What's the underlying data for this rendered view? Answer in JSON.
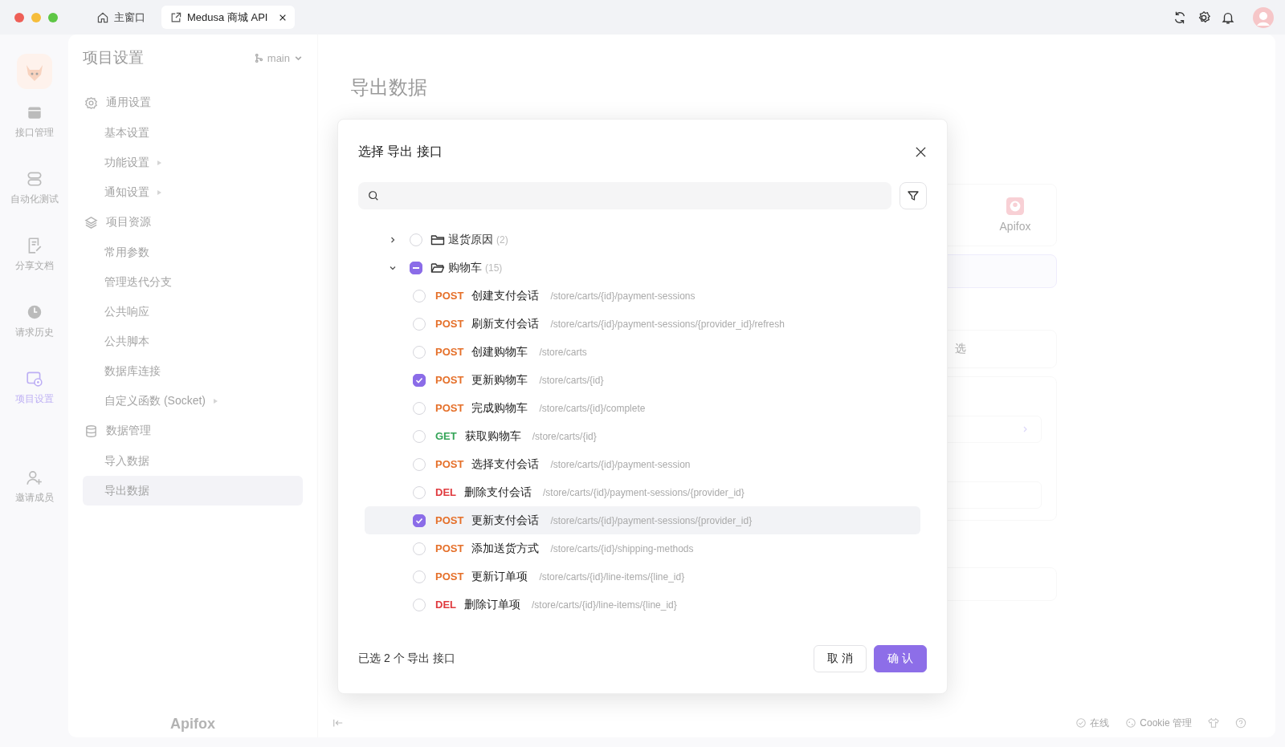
{
  "tabs": [
    {
      "kind": "home",
      "label": "主窗口",
      "selected": false
    },
    {
      "kind": "project",
      "label": "Medusa 商城 API",
      "selected": true
    }
  ],
  "rail": [
    {
      "kind": "api",
      "label": "接口管理",
      "selected": false
    },
    {
      "kind": "automation",
      "label": "自动化测试",
      "selected": false
    },
    {
      "kind": "docs",
      "label": "分享文档",
      "selected": false
    },
    {
      "kind": "history",
      "label": "请求历史",
      "selected": false
    },
    {
      "kind": "settings",
      "label": "项目设置",
      "selected": true
    },
    {
      "kind": "invite",
      "label": "邀请成员",
      "selected": false
    }
  ],
  "sidebar": {
    "title": "项目设置",
    "branch": "main",
    "brand": "Apifox",
    "groups": [
      {
        "kind": "settings",
        "label": "通用设置",
        "items": [
          {
            "label": "基本设置",
            "submenu": false,
            "selected": false
          },
          {
            "label": "功能设置",
            "submenu": true,
            "selected": false
          },
          {
            "label": "通知设置",
            "submenu": true,
            "selected": false
          }
        ]
      },
      {
        "kind": "resources",
        "label": "项目资源",
        "items": [
          {
            "label": "常用参数",
            "submenu": false,
            "selected": false
          },
          {
            "label": "管理迭代分支",
            "submenu": false,
            "selected": false
          },
          {
            "label": "公共响应",
            "submenu": false,
            "selected": false
          },
          {
            "label": "公共脚本",
            "submenu": false,
            "selected": false
          },
          {
            "label": "数据库连接",
            "submenu": false,
            "selected": false
          },
          {
            "label": "自定义函数  (Socket)",
            "submenu": true,
            "selected": false
          }
        ]
      },
      {
        "kind": "data",
        "label": "数据管理",
        "items": [
          {
            "label": "导入数据",
            "submenu": false,
            "selected": false
          },
          {
            "label": "导出数据",
            "submenu": false,
            "selected": true
          }
        ]
      }
    ]
  },
  "main": {
    "title": "导出数据",
    "format_card": {
      "label": "Apifox"
    },
    "filter_field": {
      "value": "选"
    }
  },
  "status_bar": {
    "online": "在线",
    "cookie": "Cookie 管理"
  },
  "dialog": {
    "title": "选择 导出 接口",
    "tree": [
      {
        "name": "退货原因",
        "count": "(2)",
        "expanded": false,
        "checked": false,
        "indeterminate": false
      },
      {
        "name": "购物车",
        "count": "(15)",
        "expanded": true,
        "checked": false,
        "indeterminate": true,
        "children": [
          {
            "method": "POST",
            "color": "#e5702a",
            "name": "创建支付会话",
            "path": "/store/carts/{id}/payment-sessions",
            "checked": false,
            "hovered": false
          },
          {
            "method": "POST",
            "color": "#e5702a",
            "name": "刷新支付会话",
            "path": "/store/carts/{id}/payment-sessions/{provider_id}/refresh",
            "checked": false,
            "hovered": false
          },
          {
            "method": "POST",
            "color": "#e5702a",
            "name": "创建购物车",
            "path": "/store/carts",
            "checked": false,
            "hovered": false
          },
          {
            "method": "POST",
            "color": "#e5702a",
            "name": "更新购物车",
            "path": "/store/carts/{id}",
            "checked": true,
            "hovered": false
          },
          {
            "method": "POST",
            "color": "#e5702a",
            "name": "完成购物车",
            "path": "/store/carts/{id}/complete",
            "checked": false,
            "hovered": false
          },
          {
            "method": "GET",
            "color": "#35a558",
            "name": "获取购物车",
            "path": "/store/carts/{id}",
            "checked": false,
            "hovered": false
          },
          {
            "method": "POST",
            "color": "#e5702a",
            "name": "选择支付会话",
            "path": "/store/carts/{id}/payment-session",
            "checked": false,
            "hovered": false
          },
          {
            "method": "DEL",
            "color": "#e03a3e",
            "name": "删除支付会话",
            "path": "/store/carts/{id}/payment-sessions/{provider_id}",
            "checked": false,
            "hovered": false
          },
          {
            "method": "POST",
            "color": "#e5702a",
            "name": "更新支付会话",
            "path": "/store/carts/{id}/payment-sessions/{provider_id}",
            "checked": true,
            "hovered": true
          },
          {
            "method": "POST",
            "color": "#e5702a",
            "name": "添加送货方式",
            "path": "/store/carts/{id}/shipping-methods",
            "checked": false,
            "hovered": false
          },
          {
            "method": "POST",
            "color": "#e5702a",
            "name": "更新订单项",
            "path": "/store/carts/{id}/line-items/{line_id}",
            "checked": false,
            "hovered": false
          },
          {
            "method": "DEL",
            "color": "#e03a3e",
            "name": "删除订单项",
            "path": "/store/carts/{id}/line-items/{line_id}",
            "checked": false,
            "hovered": false
          }
        ]
      }
    ],
    "summary": "已选 2 个 导出 接口",
    "cancel": "取 消",
    "confirm": "确 认"
  }
}
